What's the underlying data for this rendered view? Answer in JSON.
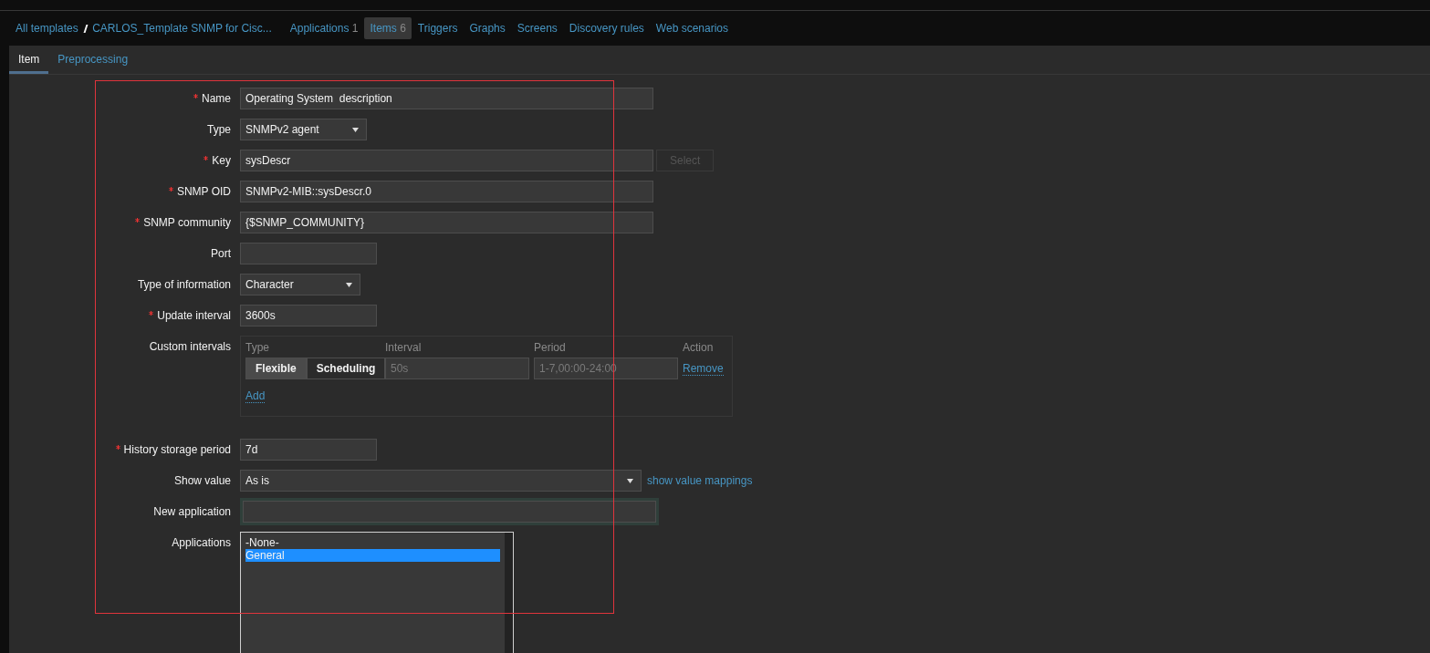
{
  "breadcrumbs": [
    "All templates",
    "CARLOS_Template SNMP for Cisc..."
  ],
  "nav": [
    {
      "label": "Applications",
      "count": "1",
      "selected": false
    },
    {
      "label": "Items",
      "count": "6",
      "selected": true
    },
    {
      "label": "Triggers",
      "selected": false
    },
    {
      "label": "Graphs",
      "selected": false
    },
    {
      "label": "Screens",
      "selected": false
    },
    {
      "label": "Discovery rules",
      "selected": false
    },
    {
      "label": "Web scenarios",
      "selected": false
    }
  ],
  "tabs": [
    {
      "label": "Item",
      "selected": true
    },
    {
      "label": "Preprocessing",
      "selected": false
    }
  ],
  "form": [
    {
      "kind": "text",
      "label": "Name",
      "required": true,
      "value": "Operating System  description"
    },
    {
      "kind": "select",
      "label": "Type",
      "required": false,
      "value": "SNMPv2 agent"
    },
    {
      "kind": "text",
      "label": "Key",
      "required": true,
      "value": "sysDescr",
      "button": {
        "label": "Select",
        "disabled": true
      }
    },
    {
      "kind": "text",
      "label": "SNMP OID",
      "required": true,
      "value": "SNMPv2-MIB::sysDescr.0"
    },
    {
      "kind": "text",
      "label": "SNMP community",
      "required": true,
      "value": "{$SNMP_COMMUNITY}"
    },
    {
      "kind": "text",
      "label": "Port",
      "required": false
    },
    {
      "kind": "select",
      "label": "Type of information",
      "required": false,
      "value": "Character"
    },
    {
      "kind": "text",
      "label": "Update interval",
      "required": true,
      "value": "3600s"
    },
    {
      "kind": "intervals",
      "label": "Custom intervals",
      "required": false,
      "columns": [
        "Type",
        "Interval",
        "Period",
        "Action"
      ],
      "rows": [
        {
          "modes": [
            {
              "label": "Flexible",
              "selected": true
            },
            {
              "label": "Scheduling",
              "selected": false
            }
          ],
          "interval_placeholder": "50s",
          "period_placeholder": "1-7,00:00-24:00",
          "action": "Remove"
        }
      ],
      "add": "Add"
    },
    {
      "kind": "text",
      "label": "History storage period",
      "required": true,
      "value": "7d"
    },
    {
      "kind": "select",
      "label": "Show value",
      "required": false,
      "value": "As is",
      "link": "show value mappings"
    },
    {
      "kind": "text",
      "label": "New application",
      "required": false,
      "focused": true
    },
    {
      "kind": "listbox",
      "label": "Applications",
      "required": false,
      "options": [
        {
          "label": "-None-",
          "selected": false
        },
        {
          "label": "General",
          "selected": true
        }
      ]
    }
  ]
}
